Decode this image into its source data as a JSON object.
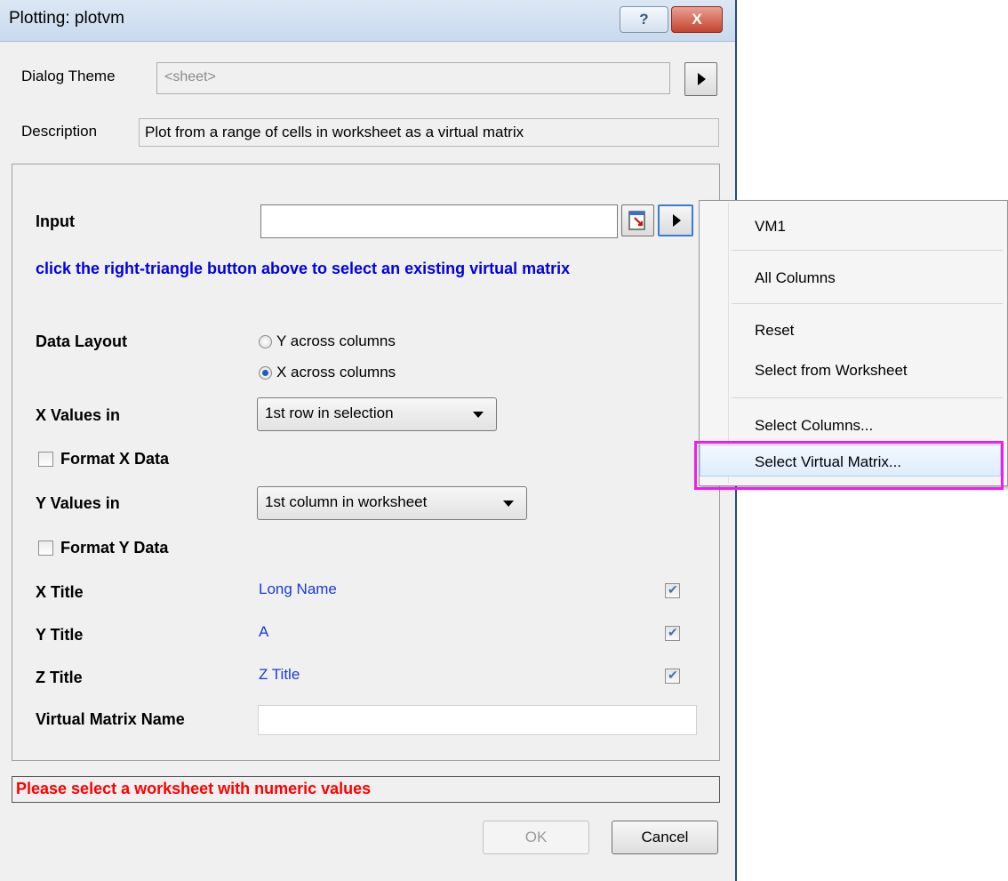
{
  "window": {
    "title": "Plotting: plotvm",
    "help_label": "?",
    "close_label": "X"
  },
  "theme": {
    "label": "Dialog Theme",
    "value": "<sheet>"
  },
  "description": {
    "label": "Description",
    "text": "Plot from a range of cells in worksheet as a virtual matrix"
  },
  "input": {
    "label": "Input",
    "value": ""
  },
  "hint": "click the right-triangle button above to select an existing virtual matrix",
  "layout": {
    "label": "Data Layout",
    "options": [
      "Y across columns",
      "X across columns"
    ],
    "selected": "X across columns"
  },
  "x_values": {
    "label": "X Values in",
    "value": "1st row in selection"
  },
  "format_x": {
    "label": "Format X Data",
    "checked": false
  },
  "y_values": {
    "label": "Y Values in",
    "value": "1st column in worksheet"
  },
  "format_y": {
    "label": "Format Y Data",
    "checked": false
  },
  "titles": [
    {
      "label": "X Title",
      "value": "Long Name",
      "checked": true
    },
    {
      "label": "Y Title",
      "value": "A",
      "checked": true
    },
    {
      "label": "Z Title",
      "value": "Z Title",
      "checked": true
    }
  ],
  "vm_name": {
    "label": "Virtual Matrix Name",
    "value": ""
  },
  "status": "Please select a worksheet with numeric values",
  "buttons": {
    "ok": "OK",
    "cancel": "Cancel"
  },
  "menu": {
    "items": [
      "VM1",
      "All Columns",
      "Reset",
      "Select from Worksheet",
      "Select Columns...",
      "Select Virtual Matrix..."
    ],
    "highlighted": "Select Virtual Matrix..."
  },
  "colors": {
    "hint": "#0000e6",
    "status": "#ff0000",
    "value_blue": "#1a3bd6",
    "highlight_box": "#f01cf2"
  }
}
